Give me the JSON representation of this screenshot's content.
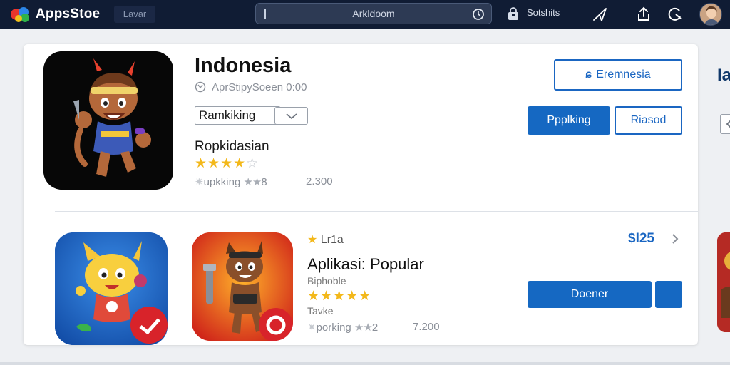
{
  "topbar": {
    "app_name": "AppsStoe",
    "tab_label": "Lavar",
    "search_value": "Arkldoom",
    "store_label": "Sotshits",
    "icons": [
      "store-logo-icon",
      "search-clock-icon",
      "bag-icon",
      "send-icon",
      "share-icon",
      "refresh-icon",
      "avatar"
    ]
  },
  "featured": {
    "title": "Indonesia",
    "meta": "AprStipySoeen 0:00",
    "sort_label": "Ramkiking",
    "category": "Ropkidasian",
    "stars": "★★★★",
    "stars_off": "☆",
    "rank_label": "upkking",
    "rank_stars": "★★",
    "rank_num": "8",
    "count": "2.300",
    "btn_outline_label": "Eremnesia",
    "btn_primary_label": "Ppplking",
    "btn_secondary_label": "Riasod"
  },
  "popular": {
    "category": "Lr1a",
    "title": "Aplikasi: Popular",
    "subtitle": "Biphoble",
    "stars": "★★★★★",
    "tag": "Tavke",
    "rank_label": "porking",
    "rank_stars": "★★",
    "rank_num": "2",
    "count": "7.200",
    "price": "$I25",
    "btn_primary_label": "Doener"
  },
  "peek": {
    "title": "Ia"
  },
  "colors": {
    "topbar": "#101c34",
    "accent": "#1568c2",
    "star": "#f3b81a"
  }
}
